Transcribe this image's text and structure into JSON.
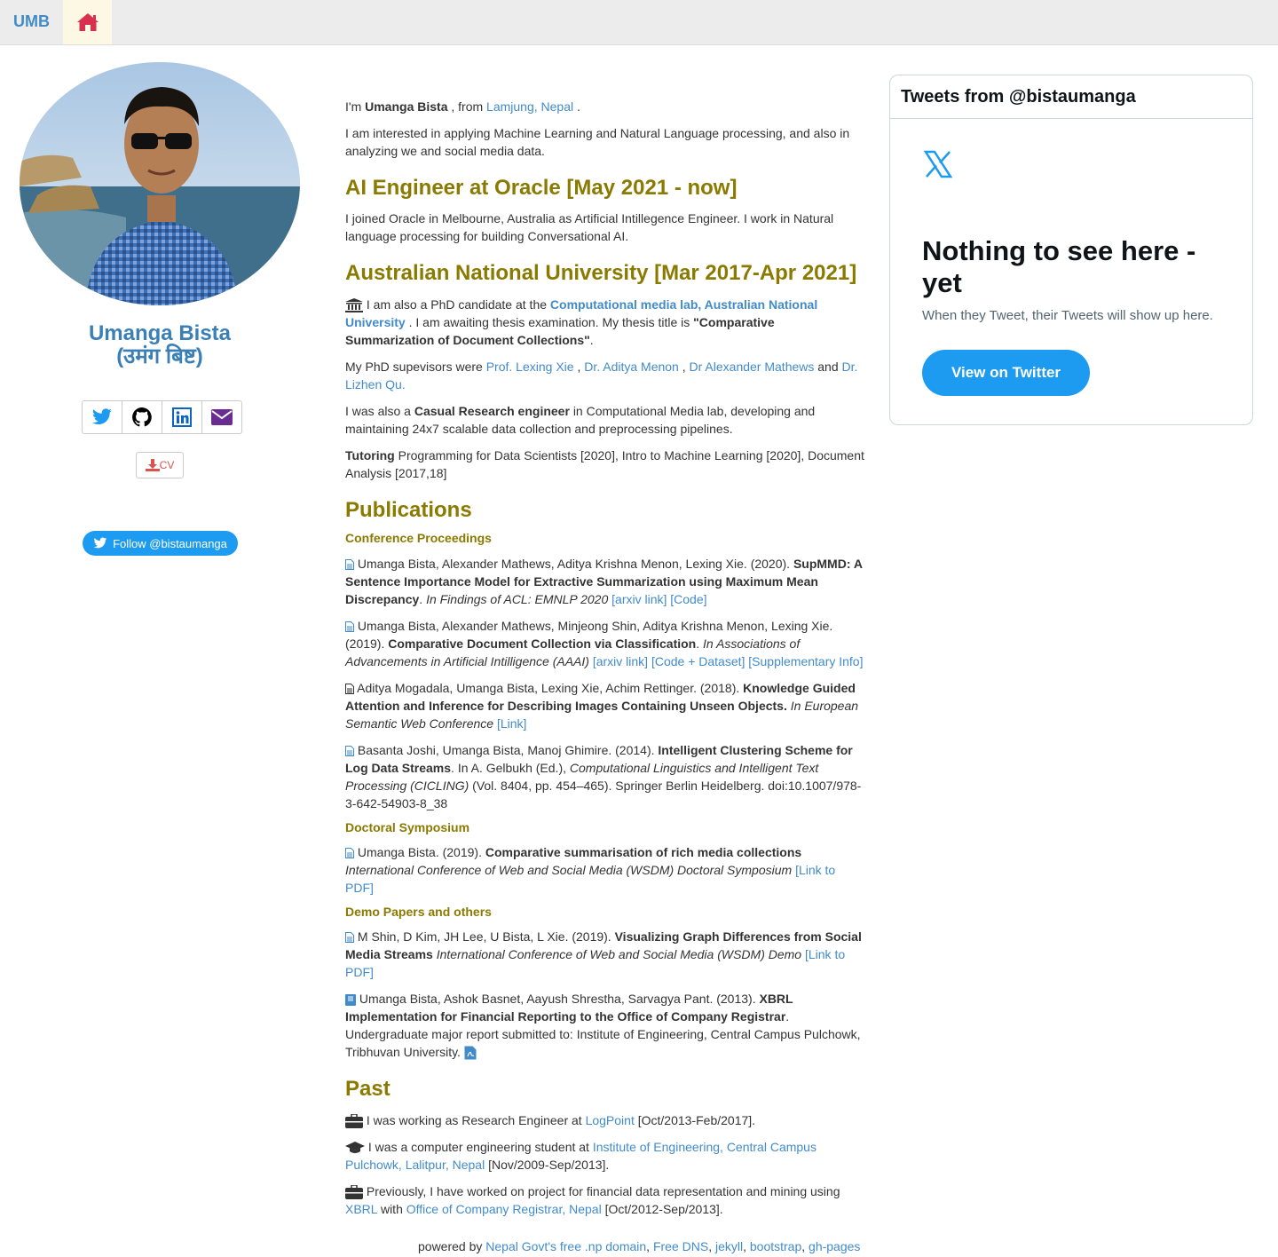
{
  "nav": {
    "brand": "UMB",
    "home_icon": "home-icon"
  },
  "profile": {
    "name": "Umanga Bista",
    "name_native": "(उमंग बिष्ट)",
    "cv_label": "CV",
    "follow_label": "Follow @bistaumanga",
    "social": [
      "twitter-icon",
      "github-icon",
      "linkedin-icon",
      "envelope-icon"
    ]
  },
  "intro": {
    "im": "I'm",
    "name": "Umanga Bista",
    "from": ", from",
    "place": "Lamjung, Nepal",
    "dot": ".",
    "interest": "I am interested in applying Machine Learning and Natural Language processing, and also in analyzing we and social media data."
  },
  "oracle": {
    "heading": "AI Engineer at Oracle [May 2021 - now]",
    "text": "I joined Oracle in Melbourne, Australia as Artificial Intillegence Engineer. I work in Natural language processing for building Conversational AI."
  },
  "anu": {
    "heading": "Australian National University [Mar 2017-Apr 2021]",
    "p1_a": "I am also a PhD candidate at the",
    "p1_link": "Computational media lab, Australian National University",
    "p1_b": ". I am awaiting thesis examination. My thesis title is",
    "p1_title": "\"Comparative Summarization of Document Collections\"",
    "p1_c": ".",
    "p2_a": "My PhD supevisors were",
    "sup1": "Prof. Lexing Xie",
    "sup2": "Dr. Aditya Menon",
    "sup3": "Dr Alexander Mathews",
    "and": "and",
    "sup4": "Dr. Lizhen Qu.",
    "comma": ",",
    "p3_a": "I was also a",
    "p3_b": "Casual Research engineer",
    "p3_c": "in Computational Media lab, developing and maintaining 24x7 scalable data collection and preprocessing pipelines.",
    "p4_a": "Tutoring",
    "p4_b": "Programming for Data Scientists [2020], Intro to Machine Learning [2020], Document Analysis [2017,18]"
  },
  "pubs": {
    "heading": "Publications",
    "conf_heading": "Conference Proceedings",
    "doc_heading": "Doctoral Symposium",
    "demo_heading": "Demo Papers and others",
    "p1": {
      "authors": "Umanga Bista, Alexander Mathews, Aditya Krishna Menon, Lexing Xie. (2020).",
      "title": "SupMMD: A Sentence Importance Model for Extractive Summarization using Maximum Mean Discrepancy",
      "venue": "In Findings of ACL: EMNLP 2020",
      "l1": "[arxiv link]",
      "l2": "[Code]"
    },
    "p2": {
      "authors": "Umanga Bista, Alexander Mathews, Minjeong Shin, Aditya Krishna Menon, Lexing Xie. (2019).",
      "title": "Comparative Document Collection via Classification",
      "venue": "In Associations of Advancements in Artificial Intilligence (AAAI)",
      "l1": "[arxiv link]",
      "l2": "[Code + Dataset]",
      "l3": "[Supplementary Info]"
    },
    "p3": {
      "authors": "Aditya Mogadala, Umanga Bista, Lexing Xie, Achim Rettinger. (2018).",
      "title": "Knowledge Guided Attention and Inference for Describing Images Containing Unseen Objects.",
      "venue": "In European Semantic Web Conference",
      "l1": "[Link]"
    },
    "p4": {
      "authors": "Basanta Joshi, Umanga Bista, Manoj Ghimire. (2014).",
      "title": "Intelligent Clustering Scheme for Log Data Streams",
      "ed": ". In A. Gelbukh (Ed.),",
      "venue": "Computational Linguistics and Intelligent Text Processing (CICLING)",
      "rest": "(Vol. 8404, pp. 454–465). Springer Berlin Heidelberg. doi:10.1007/978-3-642-54903-8_38"
    },
    "p5": {
      "authors": "Umanga Bista. (2019).",
      "title": "Comparative summarisation of rich media collections",
      "venue": "International Conference of Web and Social Media (WSDM) Doctoral Symposium",
      "l1": "[Link to PDF]"
    },
    "p6": {
      "authors": "M Shin, D Kim, JH Lee, U Bista, L Xie. (2019).",
      "title": "Visualizing Graph Differences from Social Media Streams",
      "venue": "International Conference of Web and Social Media (WSDM) Demo",
      "l1": "[Link to PDF]"
    },
    "p7": {
      "authors": "Umanga Bista, Ashok Basnet, Aayush Shrestha, Sarvagya Pant. (2013).",
      "title": "XBRL Implementation for Financial Reporting to the Office of Company Registrar",
      "rest": ". Undergraduate major report submitted to: Institute of Engineering, Central Campus Pulchowk, Tribhuvan University."
    }
  },
  "past": {
    "heading": "Past",
    "i1_a": "I was working as Research Engineer at",
    "i1_link": "LogPoint",
    "i1_b": "[Oct/2013-Feb/2017].",
    "i2_a": "I was a computer engineering student at",
    "i2_link": "Institute of Engineering, Central Campus Pulchowk, Lalitpur, Nepal",
    "i2_b": "[Nov/2009-Sep/2013].",
    "i3_a": "Previously, I have worked on project for financial data representation and mining using",
    "i3_link1": "XBRL",
    "i3_with": "with",
    "i3_link2": "Office of Company Registrar, Nepal",
    "i3_b": "[Oct/2012-Sep/2013]."
  },
  "footer": {
    "prefix": "powered by",
    "l1": "Nepal Govt's free .np domain",
    "l2": "Free DNS",
    "l3": "jekyll",
    "l4": "bootstrap",
    "l5": "gh-pages",
    "sep": ","
  },
  "twitter": {
    "header": "Tweets from @bistaumanga",
    "title": "Nothing to see here - yet",
    "sub": "When they Tweet, their Tweets will show up here.",
    "button": "View on Twitter"
  },
  "colors": {
    "link": "#428bca",
    "heading": "#8a7a00",
    "twitter": "#1d9bf0",
    "nav_bg": "#ececec"
  }
}
